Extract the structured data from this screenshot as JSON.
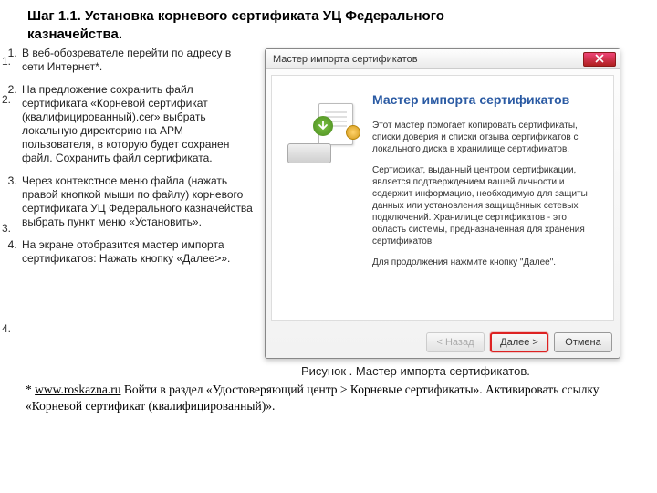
{
  "heading": "Шаг 1.1. Установка корневого сертификата УЦ Федерального казначейства.",
  "steps": [
    "В веб-обозревателе перейти по адресу в сети Интернет*.",
    "На предложение сохранить файл сертификата «Корневой сертификат (квалифицированный).cer» выбрать локальную директорию на АРМ пользователя, в которую будет сохранен файл. Сохранить файл сертификата.",
    "Через контекстное меню файла (нажать правой кнопкой мыши по файлу) корневого сертификата УЦ Федерального казначейства выбрать пункт меню «Установить».",
    "На экране отобразится мастер импорта сертификатов: Нажать кнопку «Далее>»."
  ],
  "step_numbers": [
    "1.",
    "2.",
    "3.",
    "4."
  ],
  "wizard": {
    "window_title": "Мастер импорта сертификатов",
    "heading": "Мастер импорта сертификатов",
    "para1": "Этот мастер помогает копировать сертификаты, списки доверия и списки отзыва сертификатов с локального диска в хранилище сертификатов.",
    "para2": "Сертификат, выданный центром сертификации, является подтверждением вашей личности и содержит информацию, необходимую для защиты данных или установления защищённых сетевых подключений. Хранилище сертификатов - это область системы, предназначенная для хранения сертификатов.",
    "para3": "Для продолжения нажмите кнопку \"Далее\".",
    "buttons": {
      "back": "< Назад",
      "next": "Далее >",
      "cancel": "Отмена"
    }
  },
  "figure_caption": "Рисунок . Мастер импорта сертификатов.",
  "footnote": {
    "prefix": "* ",
    "link": "www.roskazna.ru",
    "rest": "  Войти в раздел «Удостоверяющий центр > Корневые сертификаты». Активировать ссылку «Корневой сертификат (квалифицированный)»."
  }
}
